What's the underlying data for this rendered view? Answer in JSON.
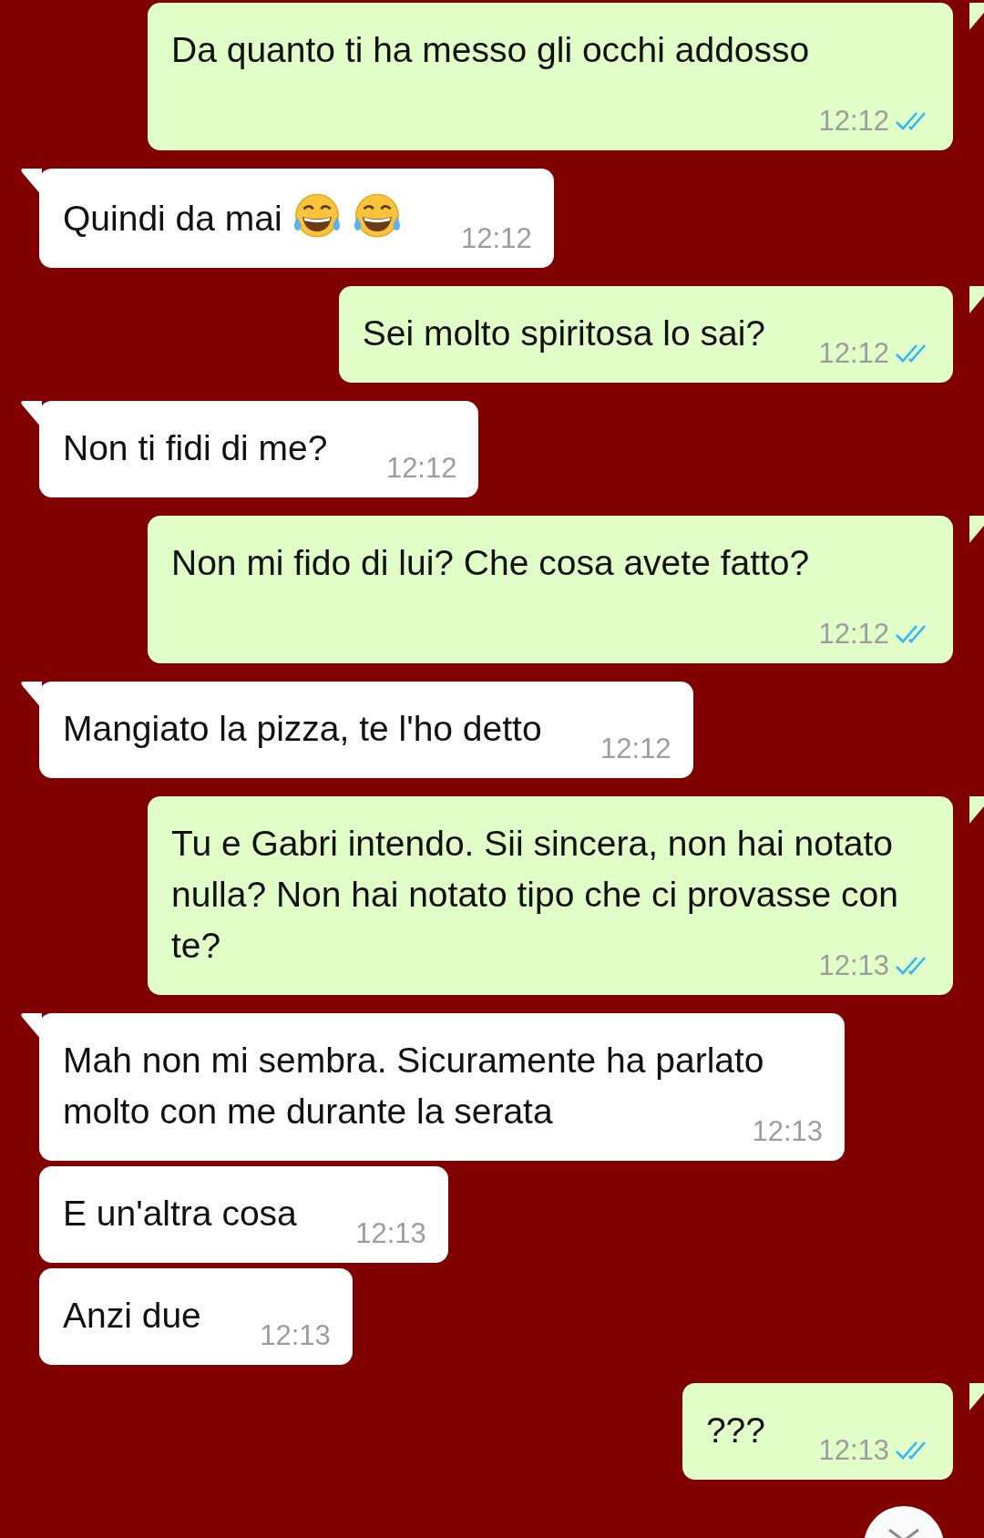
{
  "messages": [
    {
      "kind": "outgoing",
      "tail": true,
      "text": "Da quanto ti ha messo gli occhi addosso",
      "time": "12:12",
      "read": true
    },
    {
      "kind": "incoming",
      "tail": true,
      "text": "Quindi da mai",
      "emoji": [
        {
          "kind": "tears-of-joy"
        },
        {
          "kind": "tears-of-joy"
        }
      ],
      "time": "12:12"
    },
    {
      "kind": "outgoing",
      "tail": true,
      "text": "Sei molto spiritosa lo sai?",
      "time": "12:12",
      "read": true
    },
    {
      "kind": "incoming",
      "tail": true,
      "text": "Non ti fidi di me?",
      "time": "12:12"
    },
    {
      "kind": "outgoing",
      "tail": true,
      "text": "Non mi fido di lui? Che cosa avete fatto?",
      "time": "12:12",
      "read": true
    },
    {
      "kind": "incoming",
      "tail": true,
      "text": "Mangiato la pizza, te l'ho detto",
      "time": "12:12"
    },
    {
      "kind": "outgoing",
      "tail": true,
      "text": "Tu e Gabri intendo. Sii sincera, non hai notato nulla? Non hai notato tipo che ci provasse con te?",
      "time": "12:13",
      "read": true
    },
    {
      "kind": "incoming",
      "tail": true,
      "text": "Mah non mi sembra. Sicuramente ha parlato molto con me durante la serata",
      "time": "12:13"
    },
    {
      "kind": "incoming",
      "tail": false,
      "text": "E un'altra cosa",
      "time": "12:13"
    },
    {
      "kind": "incoming",
      "tail": false,
      "text": "Anzi due",
      "time": "12:13"
    },
    {
      "kind": "outgoing",
      "tail": true,
      "text": "???",
      "time": "12:13",
      "read": true
    }
  ]
}
